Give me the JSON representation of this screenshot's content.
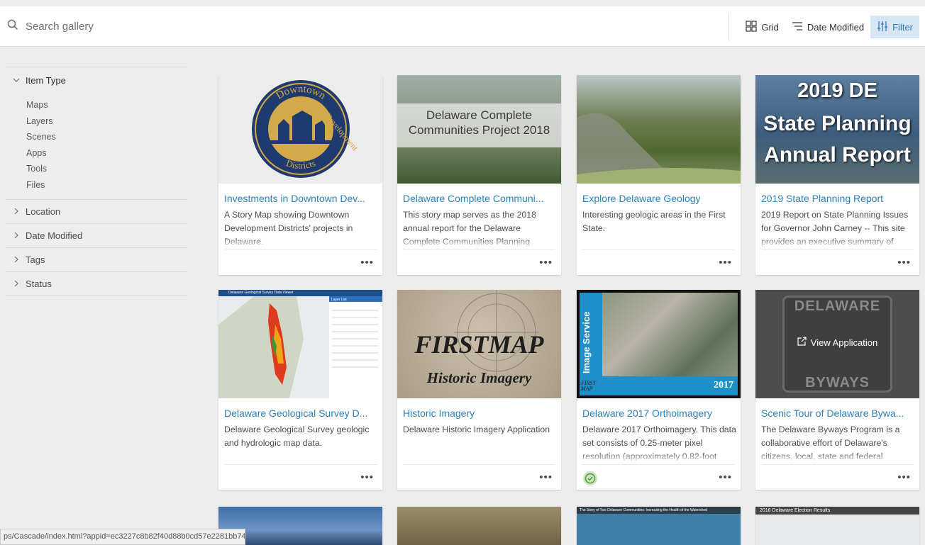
{
  "search": {
    "placeholder": "Search gallery"
  },
  "toolbar": {
    "grid_label": "Grid",
    "sort_label": "Date Modified",
    "filter_label": "Filter"
  },
  "sidebar": {
    "item_type": {
      "label": "Item Type",
      "items": [
        "Maps",
        "Layers",
        "Scenes",
        "Apps",
        "Tools",
        "Files"
      ]
    },
    "sections": [
      "Location",
      "Date Modified",
      "Tags",
      "Status"
    ]
  },
  "cards": [
    {
      "title": "Investments in Downtown Dev...",
      "desc": "A Story Map showing Downtown Development Districts' projects in Delaware.",
      "thumb_text": [
        "Downtown",
        "Development",
        "Districts"
      ]
    },
    {
      "title": "Delaware Complete Communi...",
      "desc": "This story map serves as the 2018 annual report for the Delaware Complete Communities Planning",
      "thumb_text": [
        "Delaware Complete",
        "Communities Project 2018"
      ]
    },
    {
      "title": "Explore Delaware Geology",
      "desc": "Interesting geologic areas in the First State."
    },
    {
      "title": "2019 State Planning Report",
      "desc": "2019 Report on State Planning Issues for Governor John Carney -- This site provides an executive summary of",
      "thumb_text": [
        "2019 DE",
        "State Planning",
        "Annual Report"
      ]
    },
    {
      "title": "Delaware Geological Survey D...",
      "desc": "Delaware Geological Survey geologic and hydrologic map data.",
      "thumb_text": [
        "Delaware Geological Survey Data Viewer",
        "Layer List"
      ]
    },
    {
      "title": "Historic Imagery",
      "desc": "Delaware Historic Imagery Application",
      "thumb_text": [
        "FIRSTMAP",
        "Historic Imagery"
      ]
    },
    {
      "title": "Delaware 2017 Orthoimagery",
      "desc": "Delaware 2017 Orthoimagery. This data set consists of 0.25-meter pixel resolution (approximately 0.82-foot",
      "thumb_text": [
        "Image Service",
        "2017",
        "FIRST MAP"
      ]
    },
    {
      "title": "Scenic Tour of Delaware Bywa...",
      "desc": "The Delaware Byways Program is a collaborative effort of Delaware's citizens, local, state and federal",
      "thumb_text": [
        "DELAWARE",
        "BYWAYS"
      ],
      "hover_label": "View Application"
    }
  ],
  "partial_cards": [
    {
      "text": ""
    },
    {
      "text": ""
    },
    {
      "text": "The Story of Two Delaware Communities: Increasing the Health of the Watershed"
    },
    {
      "text": "2016 Delaware Election Results"
    }
  ],
  "status_url": "ps/Cascade/index.html?appid=ec3227c8b82f40d88b0cd57e2281bb74",
  "colors": {
    "accent": "#2b7fbf",
    "filter_bg": "#d6e6f5",
    "page_bg": "#ededed"
  },
  "icons": [
    "search-icon",
    "grid-icon",
    "sort-icon",
    "filter-icon",
    "chevron-down-icon",
    "chevron-right-icon",
    "more-icon",
    "check-circle-icon",
    "external-link-icon"
  ]
}
